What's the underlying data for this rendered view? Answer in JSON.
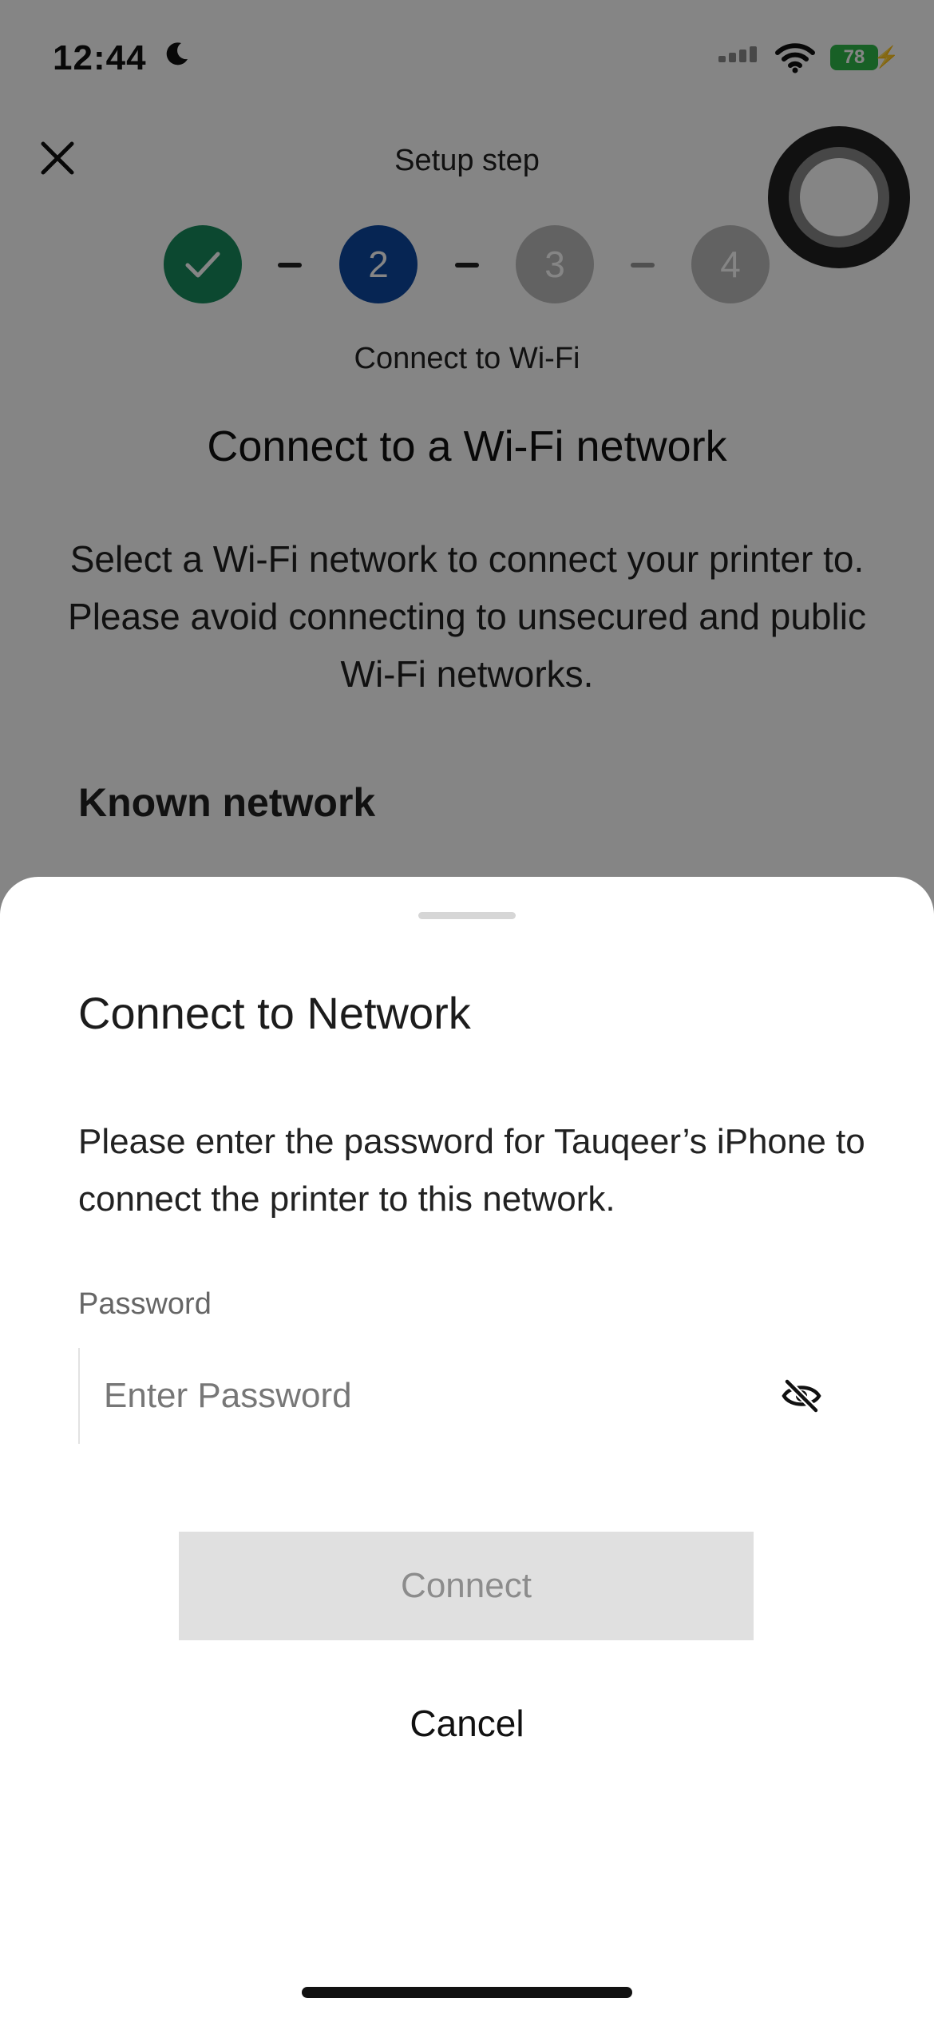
{
  "status_bar": {
    "time": "12:44",
    "battery": "78"
  },
  "header": {
    "title": "Setup step"
  },
  "stepper": {
    "steps": [
      {
        "state": "done",
        "label": ""
      },
      {
        "state": "current",
        "label": "2"
      },
      {
        "state": "upcoming",
        "label": "3"
      },
      {
        "state": "upcoming",
        "label": "4"
      }
    ],
    "current_step_name": "Connect to Wi-Fi"
  },
  "main": {
    "title": "Connect to a Wi-Fi network",
    "description": "Select a Wi-Fi network to connect your printer to. Please avoid connecting to unsecured and public Wi-Fi networks.",
    "known_network_label": "Known network"
  },
  "sheet": {
    "title": "Connect to Network",
    "message": "Please enter the password for Tauqeer’s iPhone to connect the printer to this network.",
    "password_label": "Password",
    "password_placeholder": "Enter Password",
    "password_value": "",
    "connect_label": "Connect",
    "cancel_label": "Cancel"
  },
  "colors": {
    "step_done": "#178a5c",
    "step_current": "#0c47a0",
    "step_upcoming": "#bdbdbd",
    "connect_disabled_bg": "#e0e0e0",
    "battery": "#2fb84a"
  }
}
